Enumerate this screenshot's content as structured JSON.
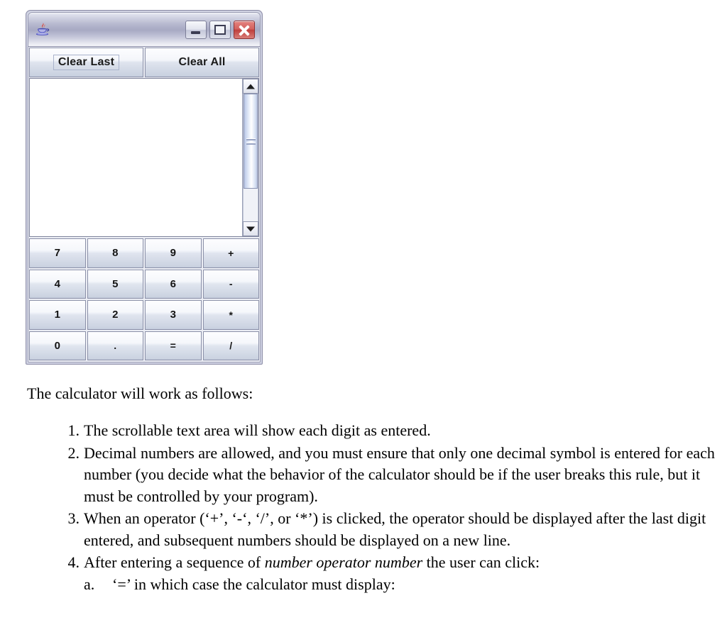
{
  "window": {
    "title": "",
    "icon": "java-coffee-cup-icon",
    "controls": {
      "minimize": "Minimize",
      "maximize": "Maximize",
      "close": "Close"
    },
    "toolbar": {
      "clear_last_label": "Clear Last",
      "clear_all_label": "Clear All"
    },
    "display": {
      "value": "",
      "placeholder": ""
    },
    "scrollbar": {
      "up_arrow": "scroll-up-arrow-icon",
      "down_arrow": "scroll-down-arrow-icon",
      "thumb": "scrollbar-thumb"
    },
    "keypad": [
      {
        "label": "7",
        "type": "digit"
      },
      {
        "label": "8",
        "type": "digit"
      },
      {
        "label": "9",
        "type": "digit"
      },
      {
        "label": "+",
        "type": "operator"
      },
      {
        "label": "4",
        "type": "digit"
      },
      {
        "label": "5",
        "type": "digit"
      },
      {
        "label": "6",
        "type": "digit"
      },
      {
        "label": "-",
        "type": "operator"
      },
      {
        "label": "1",
        "type": "digit"
      },
      {
        "label": "2",
        "type": "digit"
      },
      {
        "label": "3",
        "type": "digit"
      },
      {
        "label": "*",
        "type": "operator"
      },
      {
        "label": "0",
        "type": "digit"
      },
      {
        "label": ".",
        "type": "decimal"
      },
      {
        "label": "=",
        "type": "equals"
      },
      {
        "label": "/",
        "type": "operator"
      }
    ]
  },
  "document": {
    "intro": "The calculator will work as follows:",
    "items": [
      {
        "number": "1.",
        "text": "The scrollable text area will show each digit as entered."
      },
      {
        "number": "2.",
        "text": "Decimal numbers are allowed, and you must ensure that only one decimal symbol is entered for each number (you decide what the behavior of the calculator should be if the user breaks this rule, but it must be controlled by your program)."
      },
      {
        "number": "3.",
        "text": "When an operator (‘+’, ‘-‘, ‘/’, or ‘*’) is clicked, the operator should be displayed after the last digit entered, and subsequent numbers should be displayed on a new line."
      },
      {
        "number": "4.",
        "text_before": "After entering a sequence of ",
        "text_italic": "number operator number",
        "text_after": " the user can click:",
        "subitems": [
          {
            "number": "a.",
            "text": "‘=’ in which case the calculator must display:"
          }
        ]
      }
    ]
  },
  "colors": {
    "window_frame": "#8e8fa8",
    "titlebar_mid": "#a7a9c3",
    "button_face": "#dfe4ee",
    "close_button": "#bf3f3d",
    "text_area_bg": "#ffffff",
    "page_bg": "#ffffff"
  }
}
